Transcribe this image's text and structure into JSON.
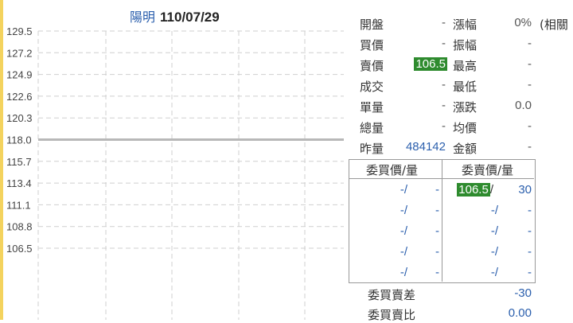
{
  "title": {
    "name": "陽明",
    "date": "110/07/29"
  },
  "chart_data": {
    "type": "line",
    "yticks": [
      "129.5",
      "127.2",
      "124.9",
      "122.6",
      "120.3",
      "118.0",
      "115.7",
      "113.4",
      "111.1",
      "108.8",
      "106.5"
    ],
    "ylim": [
      106.5,
      129.5
    ],
    "reference_line": 118.0,
    "series": []
  },
  "quote": {
    "col1": [
      {
        "label": "開盤",
        "value": "-"
      },
      {
        "label": "買價",
        "value": "-"
      },
      {
        "label": "賣價",
        "value": "106.5"
      },
      {
        "label": "成交",
        "value": "-"
      },
      {
        "label": "單量",
        "value": "-"
      },
      {
        "label": "總量",
        "value": "-"
      },
      {
        "label": "昨量",
        "value": "484142"
      }
    ],
    "col2": [
      {
        "label": "漲幅",
        "value": "0%"
      },
      {
        "label": "振幅",
        "value": "-"
      },
      {
        "label": "最高",
        "value": "-"
      },
      {
        "label": "最低",
        "value": "-"
      },
      {
        "label": "漲跌",
        "value": "0.0"
      },
      {
        "label": "均價",
        "value": "-"
      },
      {
        "label": "金額",
        "value": "-"
      }
    ],
    "extra": "(相關"
  },
  "orderbook": {
    "bid_header": "委買價/量",
    "ask_header": "委賣價/量",
    "bids": [
      {
        "price": "-/",
        "qty": "-"
      },
      {
        "price": "-/",
        "qty": "-"
      },
      {
        "price": "-/",
        "qty": "-"
      },
      {
        "price": "-/",
        "qty": "-"
      },
      {
        "price": "-/",
        "qty": "-"
      }
    ],
    "asks": [
      {
        "price": "106.5",
        "slash": "/",
        "qty": "30"
      },
      {
        "price": "-/",
        "slash": "",
        "qty": "-"
      },
      {
        "price": "-/",
        "slash": "",
        "qty": "-"
      },
      {
        "price": "-/",
        "slash": "",
        "qty": "-"
      },
      {
        "price": "-/",
        "slash": "",
        "qty": "-"
      }
    ]
  },
  "summary": [
    {
      "label": "委買賣差",
      "value": "-30"
    },
    {
      "label": "委買賣比",
      "value": "0.00"
    }
  ]
}
